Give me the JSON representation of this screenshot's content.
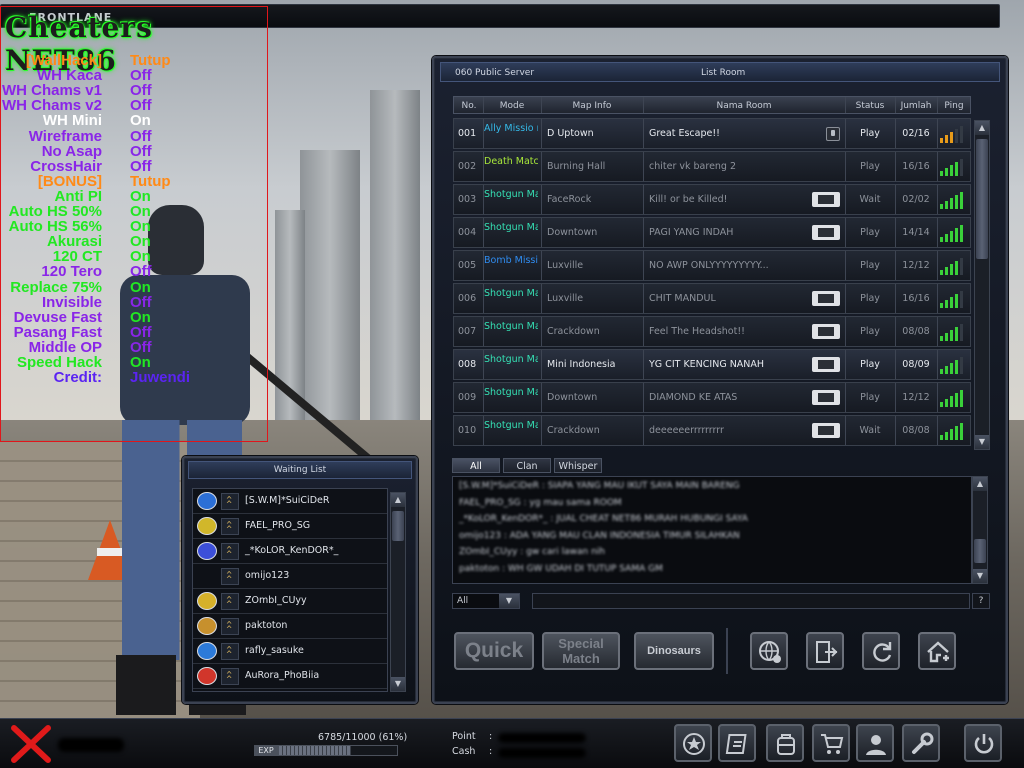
{
  "topbar": {
    "logo": "FRONTLANE"
  },
  "cheat": {
    "title": "Cheaters NET86",
    "rows": [
      {
        "label": "[WallHack]",
        "value": "Tutup",
        "label_color": "orange",
        "value_color": "orange"
      },
      {
        "label": "WH Kaca",
        "value": "Off",
        "label_color": "purple",
        "value_color": "purple"
      },
      {
        "label": "WH Chams v1",
        "value": "Off",
        "label_color": "purple",
        "value_color": "purple"
      },
      {
        "label": "WH Chams v2",
        "value": "Off",
        "label_color": "purple",
        "value_color": "purple"
      },
      {
        "label": "WH Mini",
        "value": "On",
        "label_color": "white",
        "value_color": "white"
      },
      {
        "label": "Wireframe",
        "value": "Off",
        "label_color": "purple",
        "value_color": "purple"
      },
      {
        "label": "No Asap",
        "value": "Off",
        "label_color": "purple",
        "value_color": "purple"
      },
      {
        "label": "CrossHair",
        "value": "Off",
        "label_color": "purple",
        "value_color": "purple"
      },
      {
        "label": "[BONUS]",
        "value": "Tutup",
        "label_color": "orange",
        "value_color": "orange"
      },
      {
        "label": "Anti PI",
        "value": "On",
        "label_color": "green",
        "value_color": "green"
      },
      {
        "label": "Auto HS 50%",
        "value": "On",
        "label_color": "green",
        "value_color": "green"
      },
      {
        "label": "Auto HS 56%",
        "value": "On",
        "label_color": "green",
        "value_color": "green"
      },
      {
        "label": "Akurasi",
        "value": "On",
        "label_color": "green",
        "value_color": "green"
      },
      {
        "label": "120 CT",
        "value": "On",
        "label_color": "green",
        "value_color": "green"
      },
      {
        "label": "120 Tero",
        "value": "Off",
        "label_color": "purple",
        "value_color": "purple"
      },
      {
        "label": "Replace 75%",
        "value": "On",
        "label_color": "green",
        "value_color": "green"
      },
      {
        "label": "Invisible",
        "value": "Off",
        "label_color": "purple",
        "value_color": "purple"
      },
      {
        "label": "Devuse Fast",
        "value": "On",
        "label_color": "purple",
        "value_color": "green"
      },
      {
        "label": "Pasang Fast",
        "value": "Off",
        "label_color": "purple",
        "value_color": "purple"
      },
      {
        "label": "Middle OP",
        "value": "Off",
        "label_color": "purple",
        "value_color": "purple"
      },
      {
        "label": "Speed Hack",
        "value": "On",
        "label_color": "green",
        "value_color": "green"
      },
      {
        "label": "Credit:",
        "value": "Juwendi",
        "label_color": "blue",
        "value_color": "blue"
      }
    ]
  },
  "list_room": {
    "server": "060 Public Server",
    "title": "List Room",
    "headers": {
      "no": "No.",
      "mode": "Mode",
      "map": "Map Info",
      "room": "Nama Room",
      "status": "Status",
      "jumlah": "Jumlah",
      "ping": "Ping"
    },
    "rooms": [
      {
        "no": "001",
        "mode": "Ally Missio n",
        "mode_color": "#35b9e8",
        "map": "D Uptown",
        "room": "Great Escape!!",
        "status": "Play",
        "jumlah": "02/16",
        "ping": 3,
        "ping_color": "orange",
        "icon": "lock",
        "bright": true
      },
      {
        "no": "002",
        "mode": "Death Match",
        "mode_color": "#a9e83a",
        "map": "Burning Hall",
        "room": "chiter vk bareng 2",
        "status": "Play",
        "jumlah": "16/16",
        "ping": 4,
        "ping_color": "green",
        "icon": "",
        "bright": false
      },
      {
        "no": "003",
        "mode": "Shotgun Match",
        "mode_color": "#35e0b4",
        "map": "FaceRock",
        "room": "Kill! or be Killed!",
        "status": "Wait",
        "jumlah": "02/02",
        "ping": 5,
        "ping_color": "green",
        "icon": "ammo",
        "bright": false
      },
      {
        "no": "004",
        "mode": "Shotgun Match",
        "mode_color": "#35e0b4",
        "map": "Downtown",
        "room": "PAGI YANG INDAH",
        "status": "Play",
        "jumlah": "14/14",
        "ping": 5,
        "ping_color": "green",
        "icon": "ammo",
        "bright": false
      },
      {
        "no": "005",
        "mode": "Bomb Mission",
        "mode_color": "#2f8cf0",
        "map": "Luxville",
        "room": "NO AWP ONLYYYYYYYYY...",
        "status": "Play",
        "jumlah": "12/12",
        "ping": 4,
        "ping_color": "green",
        "icon": "",
        "bright": false
      },
      {
        "no": "006",
        "mode": "Shotgun Match",
        "mode_color": "#35e0b4",
        "map": "Luxville",
        "room": "CHIT MANDUL",
        "status": "Play",
        "jumlah": "16/16",
        "ping": 4,
        "ping_color": "green",
        "icon": "ammo",
        "bright": false
      },
      {
        "no": "007",
        "mode": "Shotgun Match",
        "mode_color": "#35e0b4",
        "map": "Crackdown",
        "room": "Feel The Headshot!!",
        "status": "Play",
        "jumlah": "08/08",
        "ping": 4,
        "ping_color": "green",
        "icon": "ammo",
        "bright": false
      },
      {
        "no": "008",
        "mode": "Shotgun Match",
        "mode_color": "#35e0b4",
        "map": "Mini Indonesia",
        "room": "YG CIT KENCING NANAH",
        "status": "Play",
        "jumlah": "08/09",
        "ping": 4,
        "ping_color": "green",
        "icon": "ammo",
        "bright": true
      },
      {
        "no": "009",
        "mode": "Shotgun Match",
        "mode_color": "#35e0b4",
        "map": "Downtown",
        "room": "DIAMOND KE ATAS",
        "status": "Play",
        "jumlah": "12/12",
        "ping": 5,
        "ping_color": "green",
        "icon": "ammo",
        "bright": false
      },
      {
        "no": "010",
        "mode": "Shotgun Match",
        "mode_color": "#35e0b4",
        "map": "Crackdown",
        "room": "deeeeeerrrrrrrrr",
        "status": "Wait",
        "jumlah": "08/08",
        "ping": 5,
        "ping_color": "green",
        "icon": "ammo",
        "bright": false
      }
    ]
  },
  "chat": {
    "tabs": [
      "All",
      "Clan",
      "Whisper"
    ],
    "lines": [
      "[S.W.M]*SuiCiDeR : SIAPA YANG MAU IKUT SAYA MAIN BARENG",
      "FAEL_PRO_SG : yg mau sama ROOM",
      "_*KoLOR_KenDOR*_ : JUAL CHEAT NET86 MURAH HUBUNGI SAYA",
      "omijo123 : ADA YANG MAU CLAN INDONESIA TIMUR SILAHKAN",
      "ZOmbI_CUyy : gw cari lawan nih",
      "paktoton : WH GW UDAH DI TUTUP SAMA GM"
    ],
    "channel": "All",
    "help": "?"
  },
  "buttons": {
    "quick": "Quick",
    "special_match": "Special Match",
    "dinosaurs": "Dinosaurs"
  },
  "waiting": {
    "title": "Waiting List",
    "players": [
      {
        "name": "[S.W.M]*SuiCiDeR",
        "rank_color": "#2c6fd6"
      },
      {
        "name": "FAEL_PRO_SG",
        "rank_color": "#d1b72a"
      },
      {
        "name": "_*KoLOR_KenDOR*_",
        "rank_color": "#3c4fd9"
      },
      {
        "name": "omijo123",
        "rank_color": ""
      },
      {
        "name": "ZOmbI_CUyy",
        "rank_color": "#d6b12a"
      },
      {
        "name": "paktoton",
        "rank_color": "#c7902d"
      },
      {
        "name": "rafly_sasuke",
        "rank_color": "#2c7ad9"
      },
      {
        "name": "AuRora_PhoBiia",
        "rank_color": "#d1362b"
      }
    ]
  },
  "status_bar": {
    "exp_text": "6785/11000 (61%)",
    "exp_label": "EXP",
    "exp_progress": 0.61,
    "point_label": "Point",
    "cash_label": "Cash",
    "colon": ":"
  }
}
